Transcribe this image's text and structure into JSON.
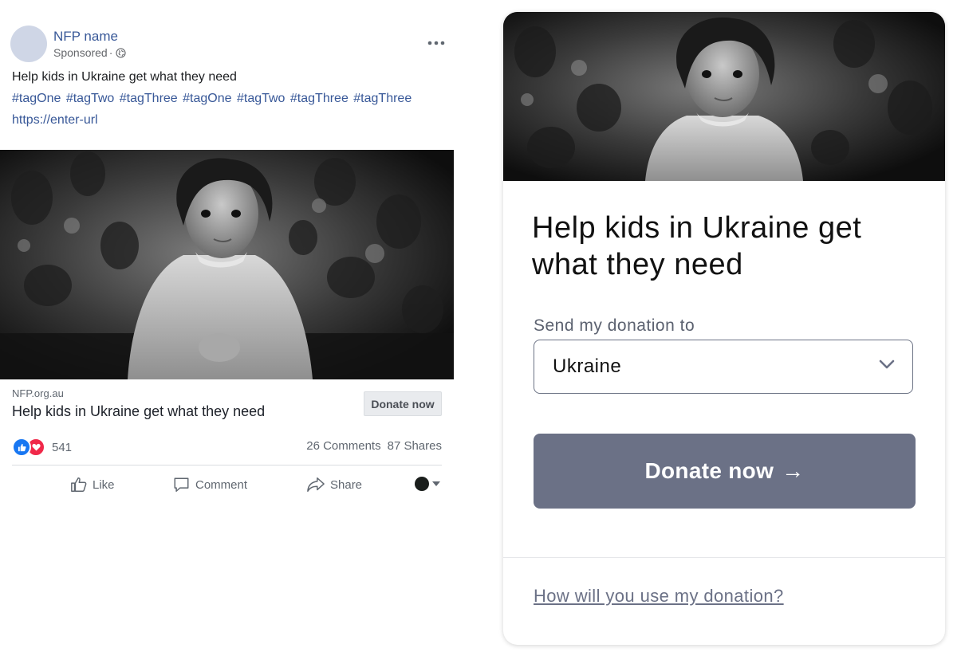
{
  "post": {
    "page_name": "NFP name",
    "sponsored": "Sponsored",
    "separator": "·",
    "text": "Help kids in Ukraine get what they need",
    "tags": "#tagOne #tagTwo #tagThree #tagOne #tagTwo #tagThree #tagThree",
    "url": "https://enter-url",
    "link_domain": "NFP.org.au",
    "link_title": "Help kids in Ukraine get what they need",
    "cta_label": "Donate now",
    "reaction_count": "541",
    "comments": "26 Comments",
    "shares": "87 Shares",
    "actions": {
      "like": "Like",
      "comment": "Comment",
      "share": "Share"
    }
  },
  "card": {
    "heading": "Help kids in Ukraine get what they need",
    "select_label": "Send my donation to",
    "selected_country": "Ukraine",
    "donate_label": "Donate now",
    "donate_arrow": "→",
    "help_link": "How will you use my donation?"
  },
  "colors": {
    "link_blue": "#385898",
    "button_slate": "#6b7186",
    "like_blue": "#1877f2",
    "love_red": "#f02849"
  }
}
